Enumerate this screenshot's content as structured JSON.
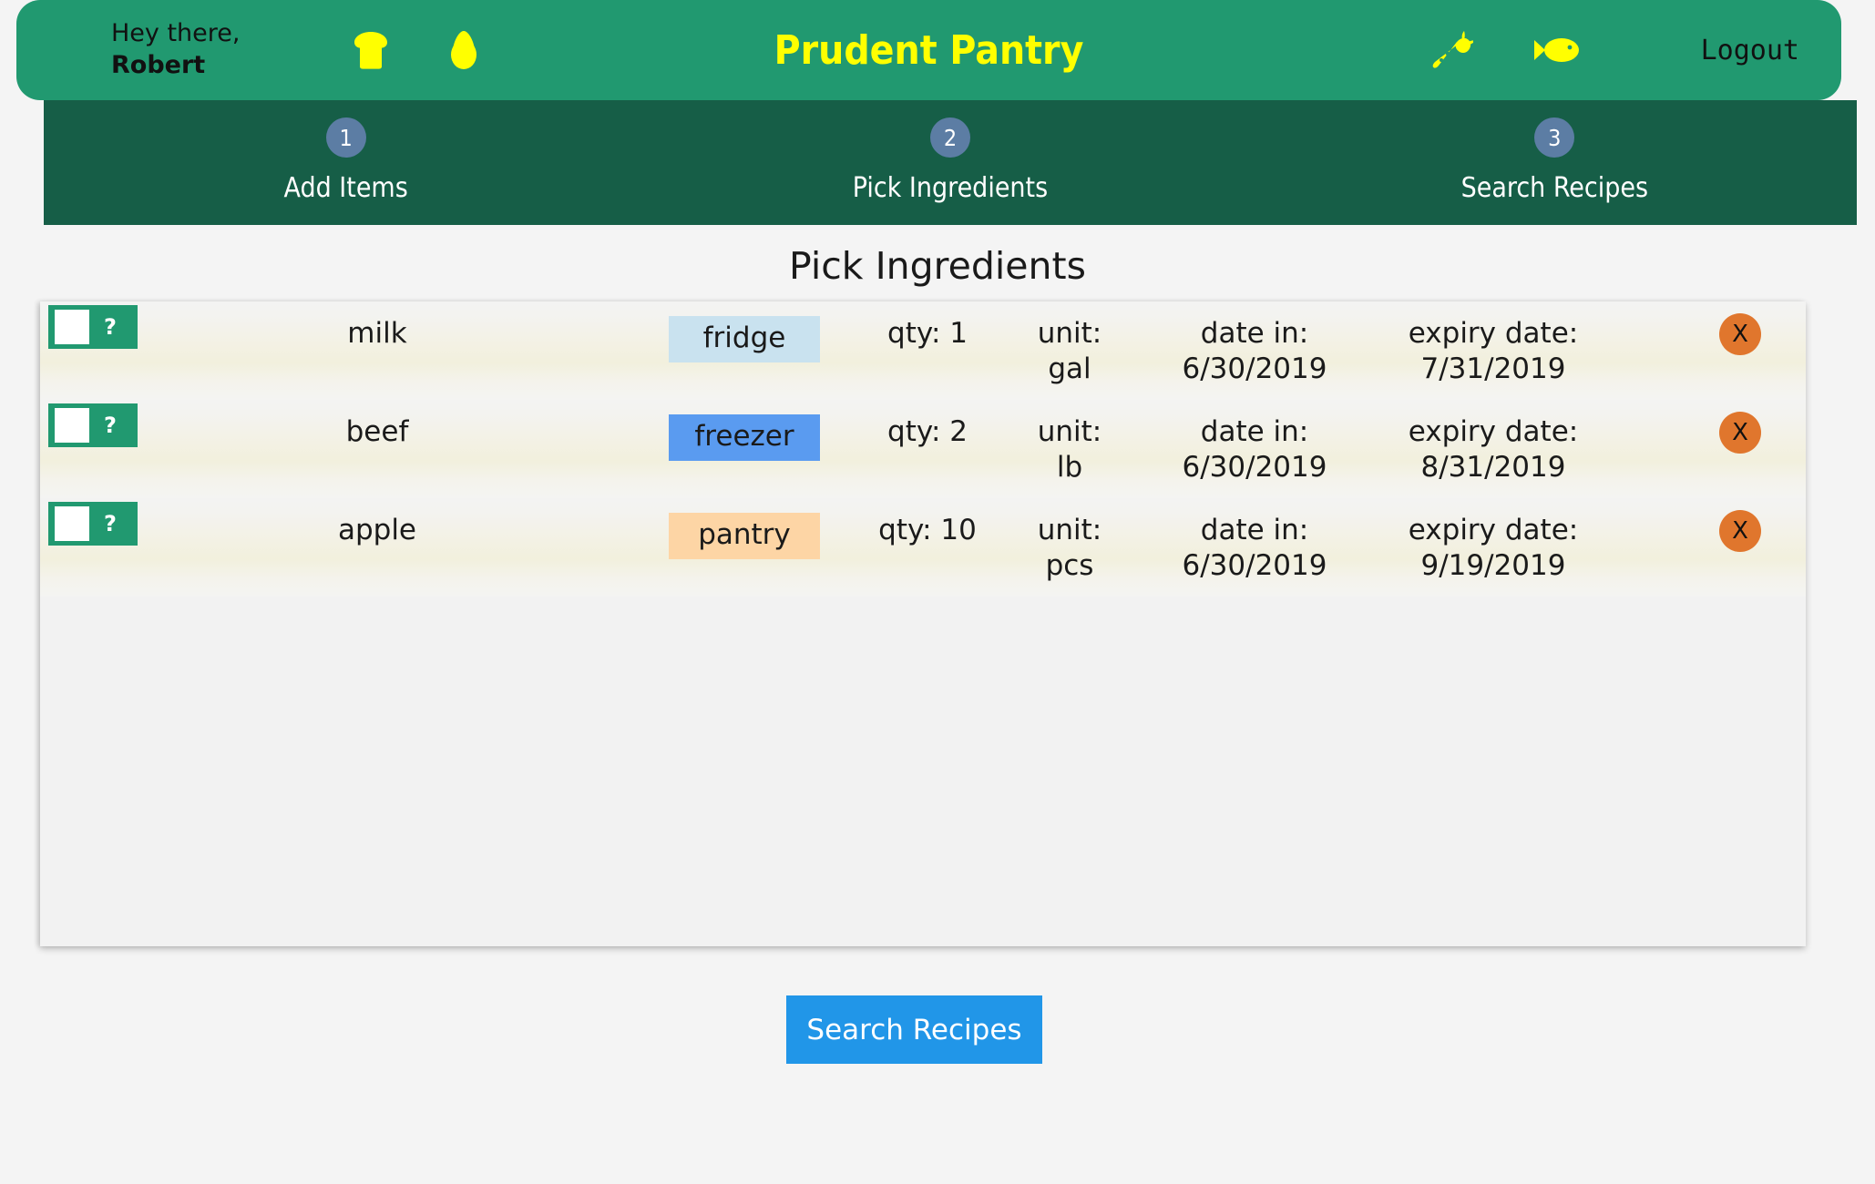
{
  "header": {
    "greeting_line1": "Hey there,",
    "username": "Robert",
    "app_title": "Prudent Pantry",
    "logout_label": "Logout",
    "icons": [
      "bread-icon",
      "egg-icon",
      "carrot-icon",
      "fish-icon"
    ],
    "bg_color": "#219970",
    "title_color": "#ffff00",
    "icon_color": "#ffff00"
  },
  "steps": {
    "bg_color": "#165e47",
    "circle_color": "#5c7da4",
    "items": [
      {
        "number": "1",
        "label": "Add Items"
      },
      {
        "number": "2",
        "label": "Pick Ingredients"
      },
      {
        "number": "3",
        "label": "Search Recipes"
      }
    ]
  },
  "section": {
    "title": "Pick Ingredients"
  },
  "table": {
    "labels": {
      "qty": "qty:",
      "unit": "unit:",
      "date_in": "date in:",
      "expiry": "expiry date:",
      "question_mark": "?",
      "delete": "X"
    },
    "location_colors": {
      "fridge": "#c9e2ef",
      "freezer": "#5a9bf0",
      "pantry": "#fdd5a5"
    },
    "rows": [
      {
        "name": "milk",
        "location": "fridge",
        "qty": "1",
        "unit": "gal",
        "date_in": "6/30/2019",
        "expiry_date": "7/31/2019",
        "checked": false
      },
      {
        "name": "beef",
        "location": "freezer",
        "qty": "2",
        "unit": "lb",
        "date_in": "6/30/2019",
        "expiry_date": "8/31/2019",
        "checked": false
      },
      {
        "name": "apple",
        "location": "pantry",
        "qty": "10",
        "unit": "pcs",
        "date_in": "6/30/2019",
        "expiry_date": "9/19/2019",
        "checked": false
      }
    ]
  },
  "footer": {
    "search_label": "Search Recipes",
    "button_color": "#2196e8"
  }
}
